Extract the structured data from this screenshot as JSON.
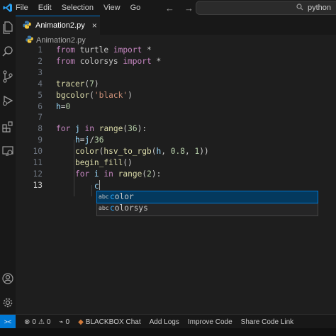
{
  "menu": {
    "items": [
      "File",
      "Edit",
      "Selection",
      "View",
      "Go"
    ]
  },
  "nav": {
    "back": "←",
    "forward": "→"
  },
  "command_center": {
    "text": "python"
  },
  "tab": {
    "name": "Animation2.py",
    "close": "×"
  },
  "breadcrumb": {
    "file": "Animation2.py"
  },
  "editor": {
    "lines": [
      {
        "n": "1",
        "tokens": [
          [
            "kw",
            "from"
          ],
          [
            "def",
            " turtle "
          ],
          [
            "kw",
            "import"
          ],
          [
            "def",
            " *"
          ]
        ]
      },
      {
        "n": "2",
        "tokens": [
          [
            "kw",
            "from"
          ],
          [
            "def",
            " colorsys "
          ],
          [
            "kw",
            "import"
          ],
          [
            "def",
            " *"
          ]
        ]
      },
      {
        "n": "3",
        "tokens": []
      },
      {
        "n": "4",
        "tokens": [
          [
            "fn",
            "tracer"
          ],
          [
            "def",
            "("
          ],
          [
            "num",
            "7"
          ],
          [
            "def",
            ")"
          ]
        ]
      },
      {
        "n": "5",
        "tokens": [
          [
            "fn",
            "bgcolor"
          ],
          [
            "def",
            "("
          ],
          [
            "str",
            "'black'"
          ],
          [
            "def",
            ")"
          ]
        ]
      },
      {
        "n": "6",
        "tokens": [
          [
            "var",
            "h"
          ],
          [
            "def",
            "="
          ],
          [
            "num",
            "0"
          ]
        ]
      },
      {
        "n": "7",
        "tokens": []
      },
      {
        "n": "8",
        "tokens": [
          [
            "kw",
            "for"
          ],
          [
            "def",
            " "
          ],
          [
            "var",
            "j"
          ],
          [
            "def",
            " "
          ],
          [
            "kw",
            "in"
          ],
          [
            "def",
            " "
          ],
          [
            "fn",
            "range"
          ],
          [
            "def",
            "("
          ],
          [
            "num",
            "36"
          ],
          [
            "def",
            "):"
          ]
        ]
      },
      {
        "n": "9",
        "tokens": [
          [
            "def",
            "    "
          ],
          [
            "var",
            "h"
          ],
          [
            "def",
            "="
          ],
          [
            "var",
            "j"
          ],
          [
            "def",
            "/"
          ],
          [
            "num",
            "36"
          ]
        ]
      },
      {
        "n": "10",
        "tokens": [
          [
            "def",
            "    "
          ],
          [
            "fn",
            "color"
          ],
          [
            "def",
            "("
          ],
          [
            "fn",
            "hsv_to_rgb"
          ],
          [
            "def",
            "("
          ],
          [
            "var",
            "h"
          ],
          [
            "def",
            ", "
          ],
          [
            "num",
            "0.8"
          ],
          [
            "def",
            ", "
          ],
          [
            "num",
            "1"
          ],
          [
            "def",
            "))"
          ]
        ]
      },
      {
        "n": "11",
        "tokens": [
          [
            "def",
            "    "
          ],
          [
            "fn",
            "begin_fill"
          ],
          [
            "def",
            "()"
          ]
        ]
      },
      {
        "n": "12",
        "tokens": [
          [
            "def",
            "    "
          ],
          [
            "kw",
            "for"
          ],
          [
            "def",
            " "
          ],
          [
            "var",
            "i"
          ],
          [
            "def",
            " "
          ],
          [
            "kw",
            "in"
          ],
          [
            "def",
            " "
          ],
          [
            "fn",
            "range"
          ],
          [
            "def",
            "("
          ],
          [
            "num",
            "2"
          ],
          [
            "def",
            "):"
          ]
        ]
      },
      {
        "n": "13",
        "tokens": [
          [
            "def",
            "        "
          ],
          [
            "var",
            "c"
          ]
        ]
      }
    ]
  },
  "suggest": {
    "items": [
      {
        "kind": "abc",
        "match": "c",
        "rest": "olor"
      },
      {
        "kind": "abc",
        "match": "c",
        "rest": "olorsys"
      }
    ]
  },
  "status": {
    "remote": "><",
    "errors": "0",
    "warnings": "0",
    "ports": "0",
    "blackbox": "BLACKBOX Chat",
    "add_logs": "Add Logs",
    "improve": "Improve Code",
    "share": "Share Code Link"
  },
  "colors": {
    "accent": "#0078d4",
    "keyword": "#c586c0",
    "function": "#dcdcaa",
    "string": "#ce9178",
    "number": "#b5cea8",
    "variable": "#9cdcfe"
  }
}
